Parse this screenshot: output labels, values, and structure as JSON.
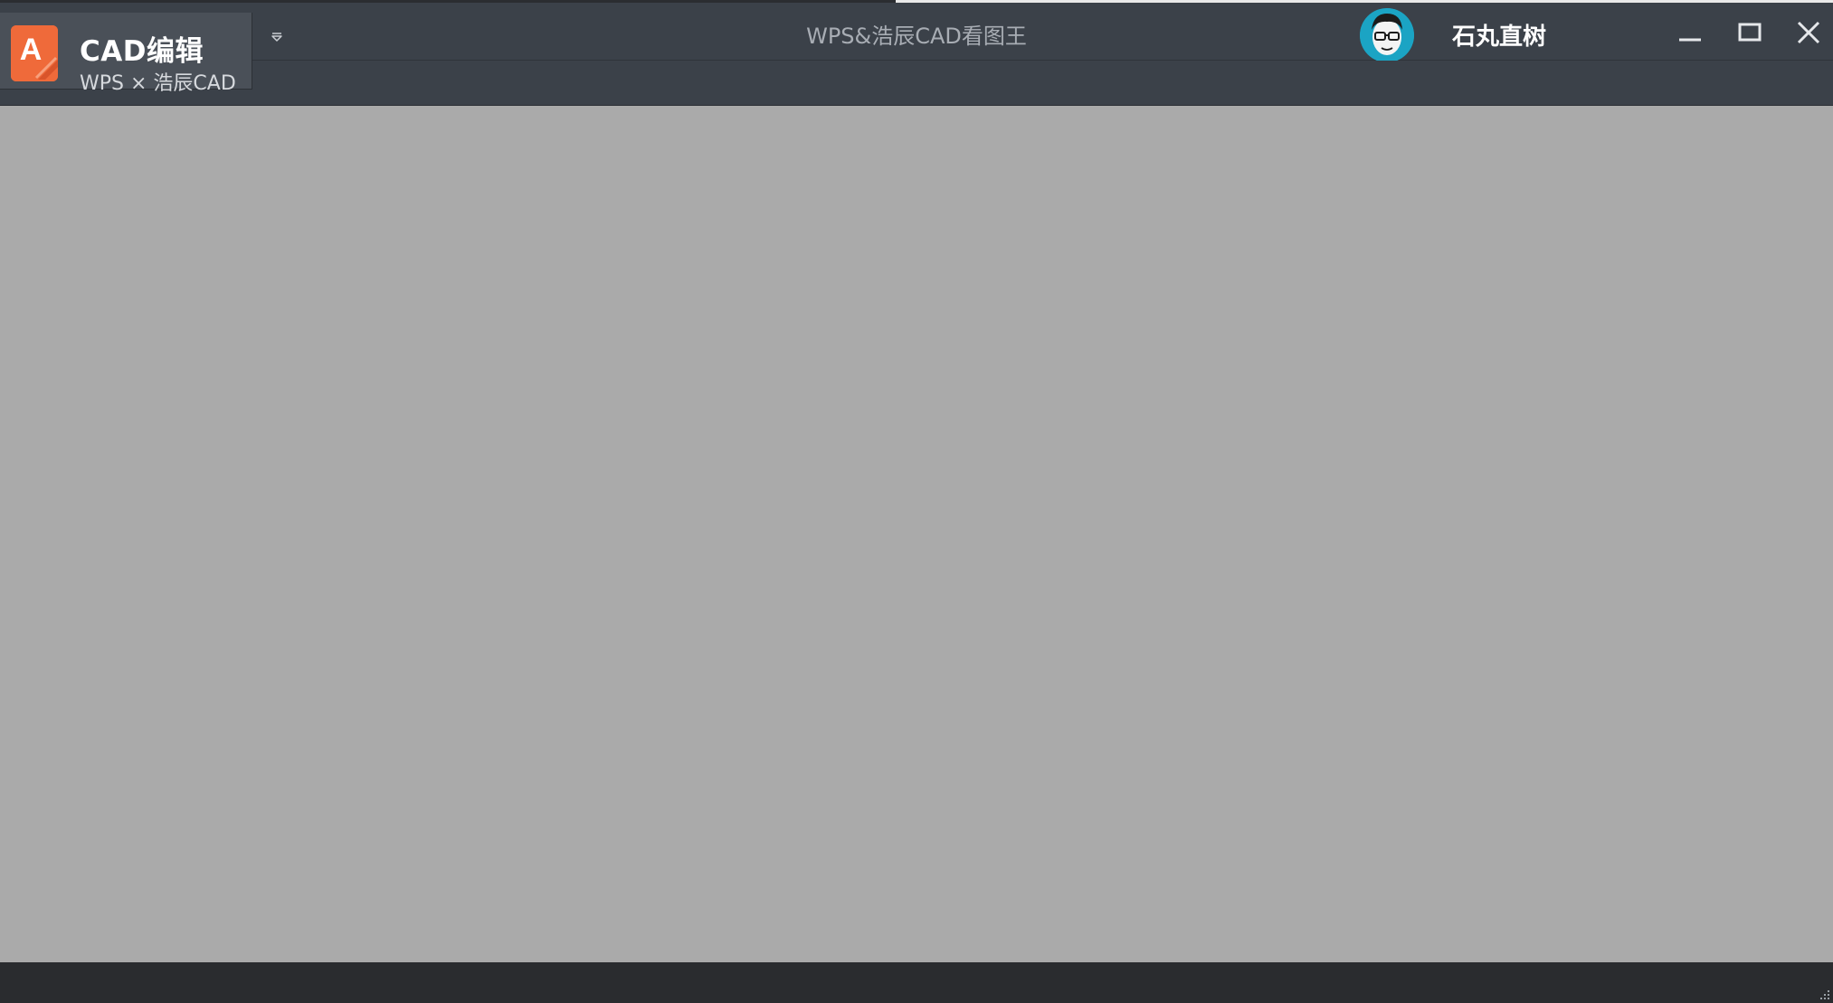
{
  "app": {
    "name": "CAD编辑",
    "subtitle": "WPS × 浩辰CAD",
    "logo_letter": "A",
    "logo_color": "#ef6a3a"
  },
  "window": {
    "title": "WPS&浩辰CAD看图王"
  },
  "user": {
    "name": "石丸直树",
    "avatar_color": "#1ba4c4"
  },
  "controls": {
    "dropdown_icon": "caret-down-icon",
    "minimize_icon": "minimize-icon",
    "maximize_icon": "maximize-icon",
    "close_icon": "close-icon"
  },
  "colors": {
    "titlebar": "#3b4149",
    "canvas": "#aaaaaa",
    "statusbar": "#2a2c2f"
  }
}
